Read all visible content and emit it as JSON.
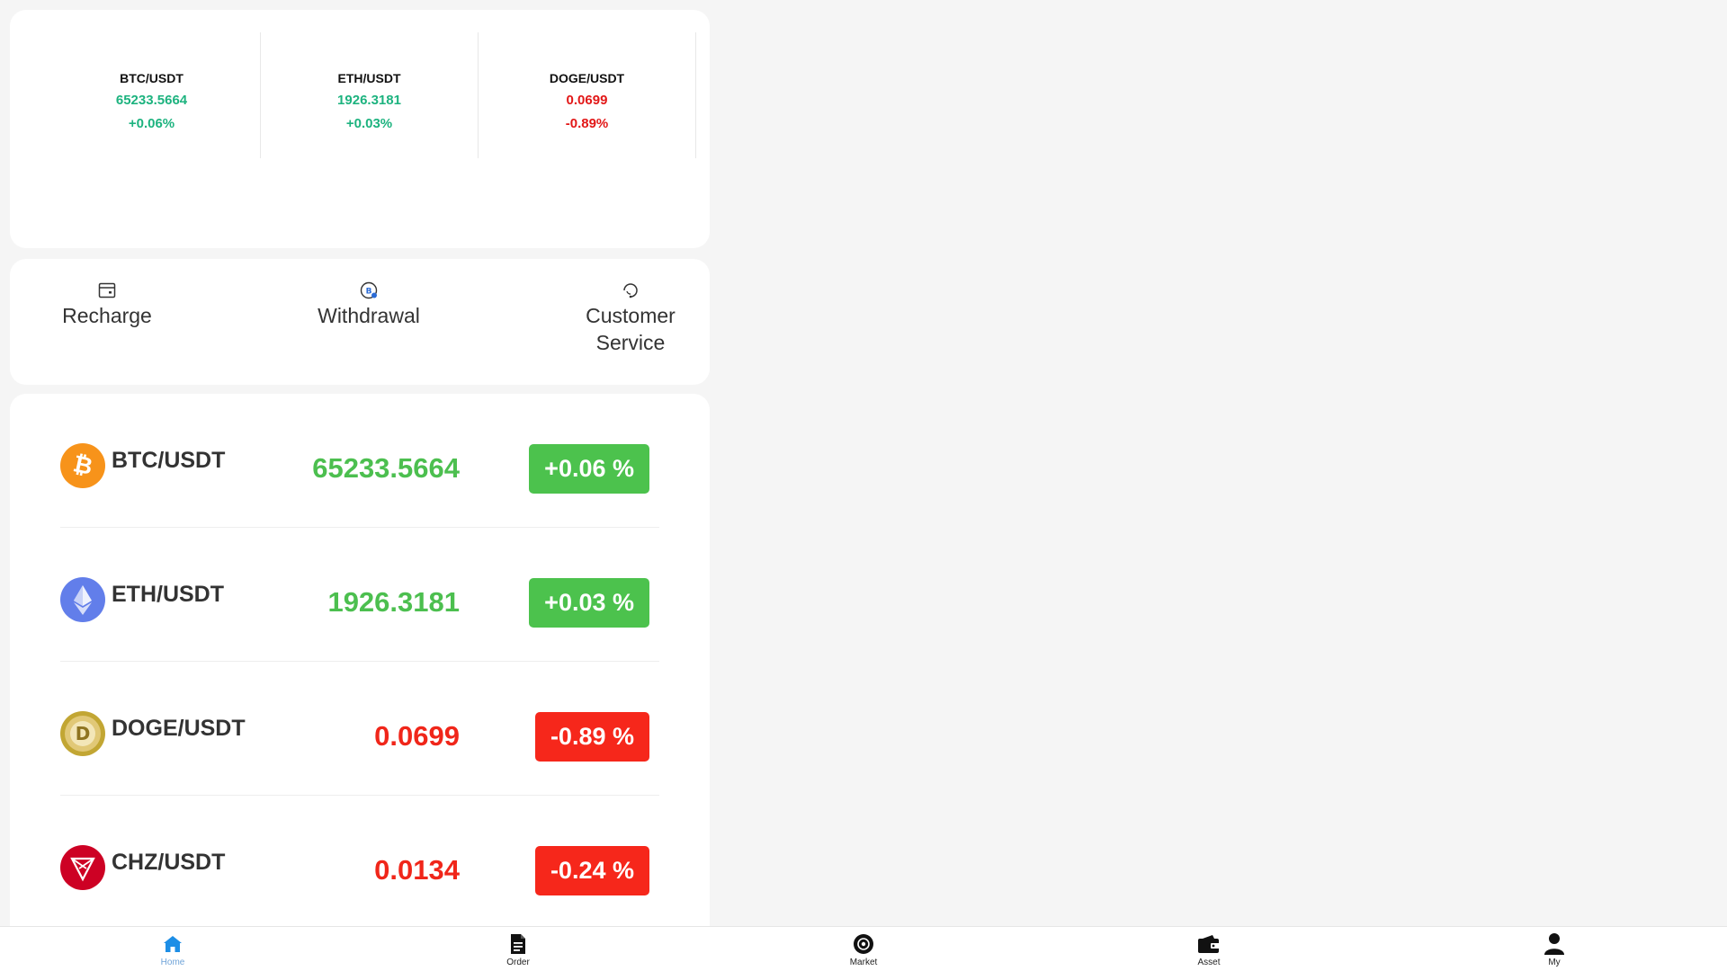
{
  "tickers": [
    {
      "pair": "BTC/USDT",
      "price": "65233.5664",
      "change": "+0.06%",
      "trend": "up"
    },
    {
      "pair": "ETH/USDT",
      "price": "1926.3181",
      "change": "+0.03%",
      "trend": "up"
    },
    {
      "pair": "DOGE/USDT",
      "price": "0.0699",
      "change": "-0.89%",
      "trend": "down"
    }
  ],
  "actions": [
    {
      "label": "Recharge",
      "icon": "wallet-icon"
    },
    {
      "label": "Withdrawal",
      "icon": "bitcoin-icon"
    },
    {
      "label": "Customer\nService",
      "icon": "headset-icon"
    }
  ],
  "market": [
    {
      "pair": "BTC/USDT",
      "price": "65233.5664",
      "change": "+0.06 %",
      "trend": "up",
      "icon": "btc-coin-icon"
    },
    {
      "pair": "ETH/USDT",
      "price": "1926.3181",
      "change": "+0.03 %",
      "trend": "up",
      "icon": "eth-coin-icon"
    },
    {
      "pair": "DOGE/USDT",
      "price": "0.0699",
      "change": "-0.89 %",
      "trend": "down",
      "icon": "doge-coin-icon"
    },
    {
      "pair": "CHZ/USDT",
      "price": "0.0134",
      "change": "-0.24 %",
      "trend": "down",
      "icon": "chz-coin-icon"
    }
  ],
  "nav": [
    {
      "label": "Home",
      "icon": "home-icon",
      "active": true
    },
    {
      "label": "Order",
      "icon": "document-icon",
      "active": false
    },
    {
      "label": "Market",
      "icon": "market-icon",
      "active": false
    },
    {
      "label": "Asset",
      "icon": "wallet-icon",
      "active": false
    },
    {
      "label": "My",
      "icon": "user-icon",
      "active": false
    }
  ],
  "colors": {
    "up_button": "#4cc24d",
    "down_button": "#f6271b",
    "up_text": "#4cbf4f",
    "down_text": "#f0261a",
    "ticker_up": "#1db37f",
    "ticker_down": "#e21717",
    "nav_active": "#1d8ee6"
  }
}
